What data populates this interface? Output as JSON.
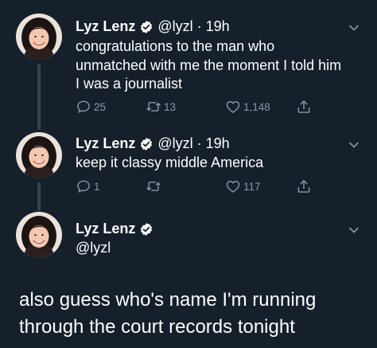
{
  "colors": {
    "background": "#15202b",
    "text": "#ffffff",
    "muted": "#8899a6",
    "thread_line": "#38444d",
    "verified_badge": "#ffffff"
  },
  "tweets": [
    {
      "name": "Lyz Lenz",
      "handle": "@lyzl",
      "dot": "·",
      "time": "19h",
      "lines": [
        "congratulations to the man who",
        "unmatched with me the moment I told him",
        "I was a journalist"
      ],
      "reply_count": "25",
      "retweet_count": "13",
      "like_count": "1,148"
    },
    {
      "name": "Lyz Lenz",
      "handle": "@lyzl",
      "dot": "·",
      "time": "19h",
      "lines": [
        "keep it classy middle America"
      ],
      "reply_count": "1",
      "retweet_count": "",
      "like_count": "117"
    }
  ],
  "profile": {
    "name": "Lyz Lenz",
    "handle": "@lyzl"
  },
  "caption": {
    "line1": "also guess who's name I'm running",
    "line2": "through the court records tonight"
  },
  "icons": {
    "verified": "verified-badge-icon",
    "chevron": "chevron-down-icon",
    "reply": "reply-icon",
    "retweet": "retweet-icon",
    "like": "heart-icon",
    "share": "share-icon"
  }
}
